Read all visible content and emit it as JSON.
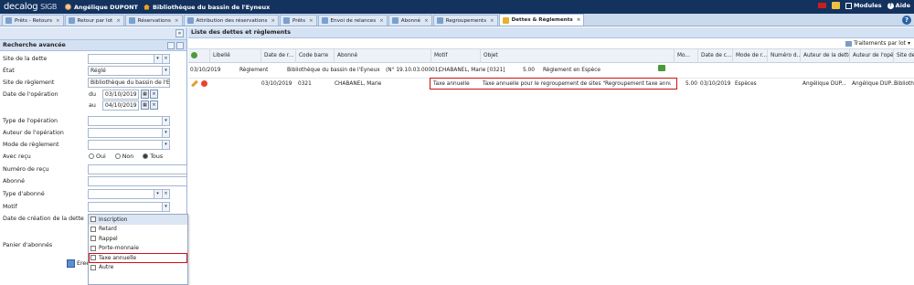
{
  "topbar": {
    "logo_main": "decalog",
    "logo_sub": "SIGB",
    "user_name": "Angélique DUPONT",
    "library_name": "Bibliothèque du bassin de l'Eyneux",
    "modules_label": "Modules",
    "help_label": "Aide"
  },
  "tabs": [
    {
      "label": "Prêts - Retours"
    },
    {
      "label": "Retour par lot"
    },
    {
      "label": "Réservations"
    },
    {
      "label": "Attribution des réservations"
    },
    {
      "label": "Prêts"
    },
    {
      "label": "Envoi de relances"
    },
    {
      "label": "Abonné"
    },
    {
      "label": "Regroupements"
    },
    {
      "label": "Dettes & Règlements"
    }
  ],
  "left": {
    "title": "Recherche avancée",
    "fields": {
      "site_dette": "Site de la dette",
      "etat": "État",
      "etat_value": "Réglé",
      "site_reglement": "Site de règlement",
      "site_reglement_value": "Bibliothèque du bassin de l'E",
      "date_operation": "Date de l'opération",
      "du": "du",
      "du_value": "03/10/2019",
      "au": "au",
      "au_value": "04/10/2019",
      "type_operation": "Type de l'opération",
      "auteur_operation": "Auteur de l'opération",
      "mode_reglement": "Mode de règlement",
      "avec_recu": "Avec reçu",
      "oui": "Oui",
      "non": "Non",
      "tous": "Tous",
      "numero_recu": "Numéro de reçu",
      "abonne": "Abonné",
      "type_abonne": "Type d'abonné",
      "motif": "Motif",
      "date_creation": "Date de création de la dette",
      "panier": "Panier d'abonnés",
      "search_partial": "Eree"
    },
    "dropdown": [
      "Inscription",
      "Retard",
      "Rappel",
      "Porte-monnaie",
      "Taxe annuelle",
      "Autre"
    ]
  },
  "right": {
    "title": "Liste des dettes et règlements",
    "toolbar_label": "Traitements par lot",
    "columns": [
      "Libellé",
      "Date de r...",
      "Code barre",
      "Abonné",
      "Motif",
      "Objet",
      "Mo...",
      "Date de c...",
      "Mode de r...",
      "Numéro d...",
      "Auteur de la dette",
      "Auteur de l'opér...",
      "Site de..."
    ],
    "group_row": {
      "date": "03/10/2019",
      "type": "Règlement",
      "site": "Bibliothèque du bassin de l'Eyneux",
      "receipt": "(N° 19.10.03.00001)",
      "patron": "CHABANEL, Marie [0321]",
      "amount": "5.00",
      "detail": "Règlement en Espèce"
    },
    "detail_row": {
      "date": "03/10/2019",
      "barcode": "0321",
      "patron": "CHABANEL, Marie",
      "motif": "Taxe annuelle",
      "objet": "Taxe annuelle pour le regroupement de sites \"Regroupement taxe annuelle Do...",
      "amount": "5.00",
      "date_c": "03/10/2019",
      "mode": "Espèces",
      "auteur_dette": "Angélique DUP...",
      "auteur_op": "Angélique DUP...",
      "site": "Bibliothèque"
    }
  }
}
